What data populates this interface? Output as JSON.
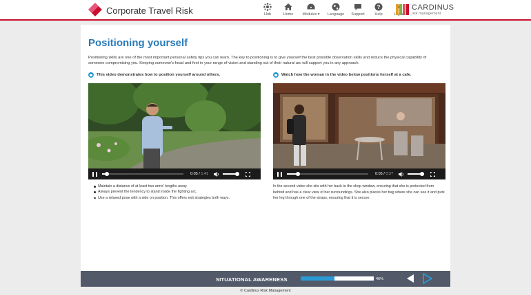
{
  "header": {
    "title": "Corporate Travel Risk",
    "nav": [
      {
        "label": "Hub",
        "icon": "hub-icon"
      },
      {
        "label": "Home",
        "icon": "home-icon"
      },
      {
        "label": "Modules",
        "icon": "dashboard-icon"
      },
      {
        "label": "Language",
        "icon": "globe-icon"
      },
      {
        "label": "Support",
        "icon": "chat-icon"
      },
      {
        "label": "Help",
        "icon": "question-icon"
      },
      {
        "label": "Logout",
        "icon": "close-icon"
      }
    ],
    "brand": {
      "name": "CARDINUS",
      "sub": "risk management",
      "colors": [
        "#e4a023",
        "#7ab648",
        "#d9534f",
        "#c8102e"
      ]
    }
  },
  "main": {
    "title": "Positioning yourself",
    "intro": "Positioning skills are one of the most important personal safety tips you can learn. The key to positioning is to give yourself the best possible observation skills and reduce the physical capability of someone compromising you. Keeping someone's head and feet in your range of vision and standing out of their natural arc will support you in any approach.",
    "left": {
      "heading": "This video demonstrates how to position yourself around others.",
      "video": {
        "current": "0:05",
        "duration": "1:41",
        "progress": 0.05,
        "volume": 0.85
      },
      "bullets": [
        "Maintain a distance of at least two arms' lengths away.",
        "Always prevent the tendency to stand inside the fighting arc.",
        "Use a relaxed pose with a side on position. This offers exit strategies both ways."
      ]
    },
    "right": {
      "heading": "Watch how the woman in the video below positions herself at a cafe.",
      "video": {
        "current": "0:05",
        "duration": "0:37",
        "progress": 0.13,
        "volume": 0.85
      },
      "description": "In the second video she sits with her back to the shop window, ensuring that she is protected from behind and has a clear view of her surroundings. She also places her bag where she can see it and puts her leg through one of the straps, ensuring that it is secure."
    }
  },
  "footer": {
    "section": "SITUATIONAL AWARENESS",
    "progress_pct": "46%",
    "progress": 0.46,
    "copyright": "© Cardinus Risk Management"
  },
  "colors": {
    "accent": "#c8102e",
    "title_blue": "#2a7ab8",
    "progress_blue": "#2a9bd4",
    "footer_bg": "#525a6a"
  }
}
